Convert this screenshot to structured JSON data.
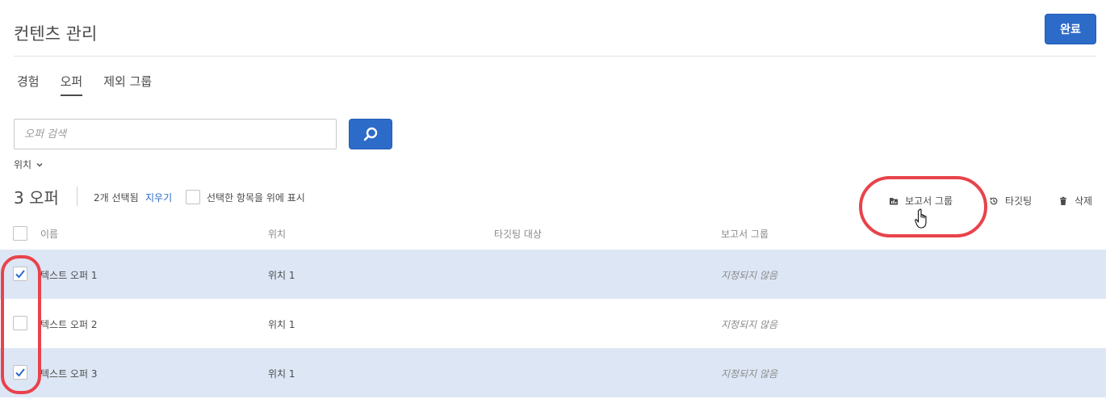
{
  "header": {
    "title": "컨텐츠 관리",
    "done_label": "완료"
  },
  "tabs": [
    {
      "label": "경험",
      "active": false
    },
    {
      "label": "오퍼",
      "active": true
    },
    {
      "label": "제외 그룹",
      "active": false
    }
  ],
  "search": {
    "placeholder": "오퍼 검색",
    "value": ""
  },
  "filter": {
    "location_label": "위치"
  },
  "summary": {
    "count_label": "3 오퍼",
    "selected_text": "2개 선택됨",
    "clear_label": "지우기",
    "show_selected_label": "선택한 항목을 위에 표시"
  },
  "actions": {
    "report_group": "보고서 그룹",
    "targeting": "타깃팅",
    "delete": "삭제"
  },
  "table": {
    "columns": [
      "이름",
      "위치",
      "타깃팅 대상",
      "보고서 그룹"
    ],
    "rows": [
      {
        "name": "텍스트 오퍼 1",
        "location": "위치 1",
        "targeting": "",
        "report_group": "지정되지 않음",
        "selected": true
      },
      {
        "name": "텍스트 오퍼 2",
        "location": "위치 1",
        "targeting": "",
        "report_group": "지정되지 않음",
        "selected": false
      },
      {
        "name": "텍스트 오퍼 3",
        "location": "위치 1",
        "targeting": "",
        "report_group": "지정되지 않음",
        "selected": true
      }
    ]
  },
  "colors": {
    "accent": "#2d6bc9",
    "selected_row": "#dde6f5",
    "highlight": "#e8434b"
  },
  "icons": {
    "search": "search-icon",
    "chevron": "chevron-down-icon",
    "report_group": "folder-chart-icon",
    "targeting": "history-icon",
    "delete": "trash-icon",
    "cursor": "hand-pointer-icon",
    "check": "checkmark-icon"
  }
}
